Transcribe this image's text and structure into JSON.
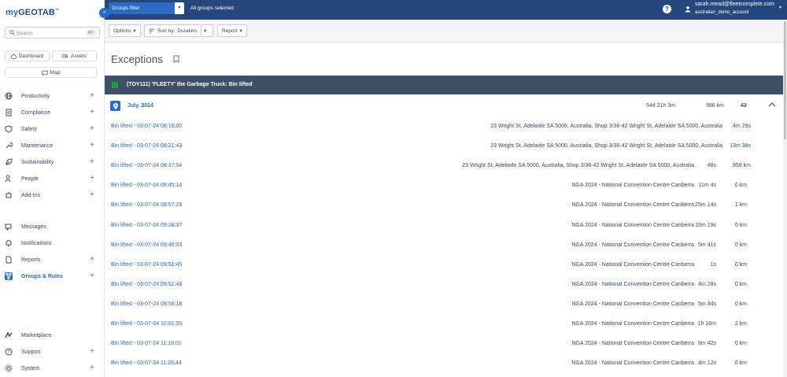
{
  "app": {
    "logo_prefix": "my",
    "logo_main": "GEOTAB",
    "logo_tm": "™"
  },
  "sidebar": {
    "collapse_label": "«",
    "search_placeholder": "Search",
    "search_shortcut": "⌘F",
    "quick_links": [
      {
        "label": "Dashboard",
        "icon": "home-icon"
      },
      {
        "label": "Assets",
        "icon": "truck-icon"
      },
      {
        "label": "Map",
        "icon": "map-icon"
      }
    ],
    "items": [
      {
        "label": "Productivity",
        "icon": "globe-icon",
        "expandable": true
      },
      {
        "label": "Compliance",
        "icon": "clipboard-icon",
        "expandable": true
      },
      {
        "label": "Safety",
        "icon": "shield-icon",
        "expandable": true
      },
      {
        "label": "Maintenance",
        "icon": "wrench-icon",
        "expandable": true
      },
      {
        "label": "Sustainability",
        "icon": "leaf-icon",
        "expandable": true
      },
      {
        "label": "People",
        "icon": "people-icon",
        "expandable": true
      },
      {
        "label": "Add-Ins",
        "icon": "puzzle-icon",
        "expandable": true
      },
      {
        "label": "Messages",
        "icon": "messages-icon",
        "expandable": false
      },
      {
        "label": "Notifications",
        "icon": "bell-icon",
        "expandable": false
      },
      {
        "label": "Reports",
        "icon": "report-icon",
        "expandable": true
      },
      {
        "label": "Groups & Rules",
        "icon": "groups-icon",
        "expandable": true,
        "active": true
      },
      {
        "label": "Marketplace",
        "icon": "marketplace-icon",
        "expandable": false
      },
      {
        "label": "Support",
        "icon": "help-circle-icon",
        "expandable": true
      },
      {
        "label": "System",
        "icon": "gear-icon",
        "expandable": true
      }
    ]
  },
  "topbar": {
    "groups_filter": "Groups filter",
    "groups_filter_caret": "▾",
    "all_groups": "All groups selected",
    "help": "?",
    "user_email": "sarah.mead@fleetcomplete.com",
    "user_account": "australian_demo_account",
    "user_caret": "▾"
  },
  "toolbar": {
    "options": "Options",
    "sort_by": "Sort by:",
    "sort_value": "Duration",
    "report": "Report",
    "caret": "▾"
  },
  "page": {
    "title": "Exceptions"
  },
  "group": {
    "title": "(TOY111) 'FLEETY' the Garbage Truck: Bin lifted",
    "color": "#1c9c4a"
  },
  "period": {
    "month": "July, 2024",
    "duration": "54d 21h 3m",
    "distance": "986 km",
    "count": "43"
  },
  "rows": [
    {
      "name": "Bin lifted - 03-07-24 08:16:00",
      "location": "23 Wright St, Adelaide SA 5000, Australia, Shop 3/36-42 Wright St, Adelaide SA 5000, Australia",
      "duration": "4m 29s",
      "distance": ""
    },
    {
      "name": "Bin lifted - 03-07-24 08:21:43",
      "location": "23 Wright St, Adelaide SA 5000, Australia, Shop 3/36-42 Wright St, Adelaide SA 5000, Australia",
      "duration": "13m 38s",
      "distance": ""
    },
    {
      "name": "Bin lifted - 03-07-24 08:37:54",
      "location": "23 Wright St, Adelaide SA 5000, Australia, Shop 3/36-42 Wright St, Adelaide SA 5000, Australia",
      "duration": "48s",
      "distance": "958 km"
    },
    {
      "name": "Bin lifted - 03-07-24 08:45:14",
      "location": "NGA 2024 - National Convention Centre Canberra",
      "duration": "11m 4s",
      "distance": "0 km"
    },
    {
      "name": "Bin lifted - 03-07-24 08:57:29",
      "location": "NGA 2024 - National Convention Centre Canberra",
      "duration": "25m 14s",
      "distance": "1 km"
    },
    {
      "name": "Bin lifted - 03-07-24 09:28:37",
      "location": "NGA 2024 - National Convention Centre Canberra",
      "duration": "15m 19s",
      "distance": "0 km"
    },
    {
      "name": "Bin lifted - 03-07-24 09:46:03",
      "location": "NGA 2024 - National Convention Centre Canberra",
      "duration": "5m 41s",
      "distance": "0 km"
    },
    {
      "name": "Bin lifted - 03-07-24 09:51:45",
      "location": "NGA 2024 - National Convention Centre Canberra",
      "duration": "1s",
      "distance": "0 km"
    },
    {
      "name": "Bin lifted - 03-07-24 09:51:48",
      "location": "NGA 2024 - National Convention Centre Canberra",
      "duration": "4m 28s",
      "distance": "0 km"
    },
    {
      "name": "Bin lifted - 03-07-24 09:56:18",
      "location": "NGA 2024 - National Convention Centre Canberra",
      "duration": "5m 34s",
      "distance": "0 km"
    },
    {
      "name": "Bin lifted - 03-07-24 10:01:55",
      "location": "NGA 2024 - National Convention Centre Canberra",
      "duration": "1h 16m",
      "distance": "2 km"
    },
    {
      "name": "Bin lifted - 03-07-24 11:18:01",
      "location": "NGA 2024 - National Convention Centre Canberra",
      "duration": "8m 42s",
      "distance": "0 km"
    },
    {
      "name": "Bin lifted - 03-07-24 11:26:44",
      "location": "NGA 2024 - National Convention Centre Canberra",
      "duration": "4m 12s",
      "distance": "0 km"
    }
  ]
}
